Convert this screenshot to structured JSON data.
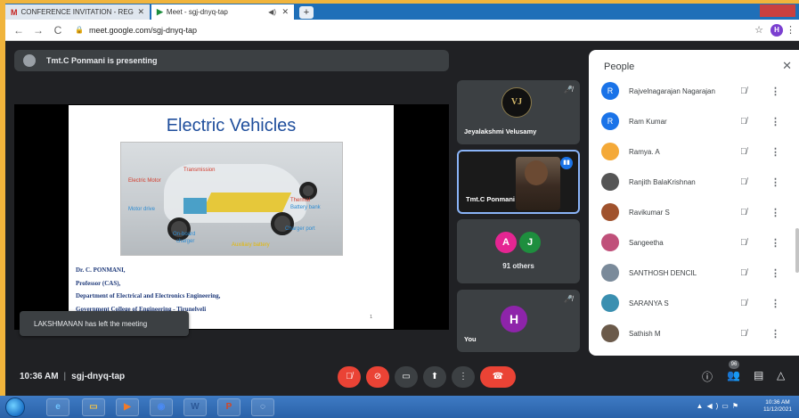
{
  "browser": {
    "tabs": [
      {
        "label": "CONFERENCE INVITATION - REG",
        "favicon": "M"
      },
      {
        "label": "Meet - sgj-dnyq-tap",
        "favicon": "▶"
      }
    ],
    "url": "meet.google.com/sgj-dnyq-tap",
    "profile_initial": "H"
  },
  "meet": {
    "presenting_text": "Tmt.C Ponmani is presenting",
    "toast": "LAKSHMANAN has left the meeting",
    "time": "10:36 AM",
    "meeting_code": "sgj-dnyq-tap",
    "participant_badge": "96"
  },
  "slide": {
    "title": "Electric Vehicles",
    "labels": {
      "transmission": "Transmission",
      "electric_motor": "Electric Motor",
      "motor_drive": "Motor drive",
      "thermal": "Thermal",
      "battery_bank": "Battery bank",
      "charger_port": "Charger port",
      "onboard": "On-board",
      "charger": "charger",
      "aux_battery": "Auxiliary battery"
    },
    "credits": [
      "Dr. C. PONMANI,",
      "Professor (CAS),",
      "Department of Electrical and Electronics Engineering,",
      "Government College of Engineering - Tirunelveli"
    ],
    "page_number": "1"
  },
  "tiles": {
    "t1": {
      "name": "Jeyalakshmi Velusamy",
      "logo": "VJ"
    },
    "t2": {
      "name": "Tmt.C Ponmani"
    },
    "t3": {
      "avatar1": "A",
      "avatar2": "J",
      "others": "91 others"
    },
    "t4": {
      "avatar": "H",
      "name": "You"
    }
  },
  "people": {
    "title": "People",
    "list": [
      {
        "name": "Rajvelnagarajan Nagarajan",
        "initial": "R",
        "color": "#1a73e8"
      },
      {
        "name": "Ram Kumar",
        "initial": "R",
        "color": "#1a73e8"
      },
      {
        "name": "Ramya. A",
        "initial": "",
        "color": "#f4a938"
      },
      {
        "name": "Ranjith BalaKrishnan",
        "initial": "",
        "color": "#555555"
      },
      {
        "name": "Ravikumar S",
        "initial": "",
        "color": "#a0522d"
      },
      {
        "name": "Sangeetha",
        "initial": "",
        "color": "#c0507a"
      },
      {
        "name": "SANTHOSH DENCIL",
        "initial": "",
        "color": "#7a8a9a"
      },
      {
        "name": "SARANYA S",
        "initial": "",
        "color": "#3a8fb0"
      },
      {
        "name": "Sathish M",
        "initial": "",
        "color": "#6b5a4a"
      }
    ]
  },
  "taskbar": {
    "clock_time": "10:36 AM",
    "clock_date": "11/12/2021"
  }
}
